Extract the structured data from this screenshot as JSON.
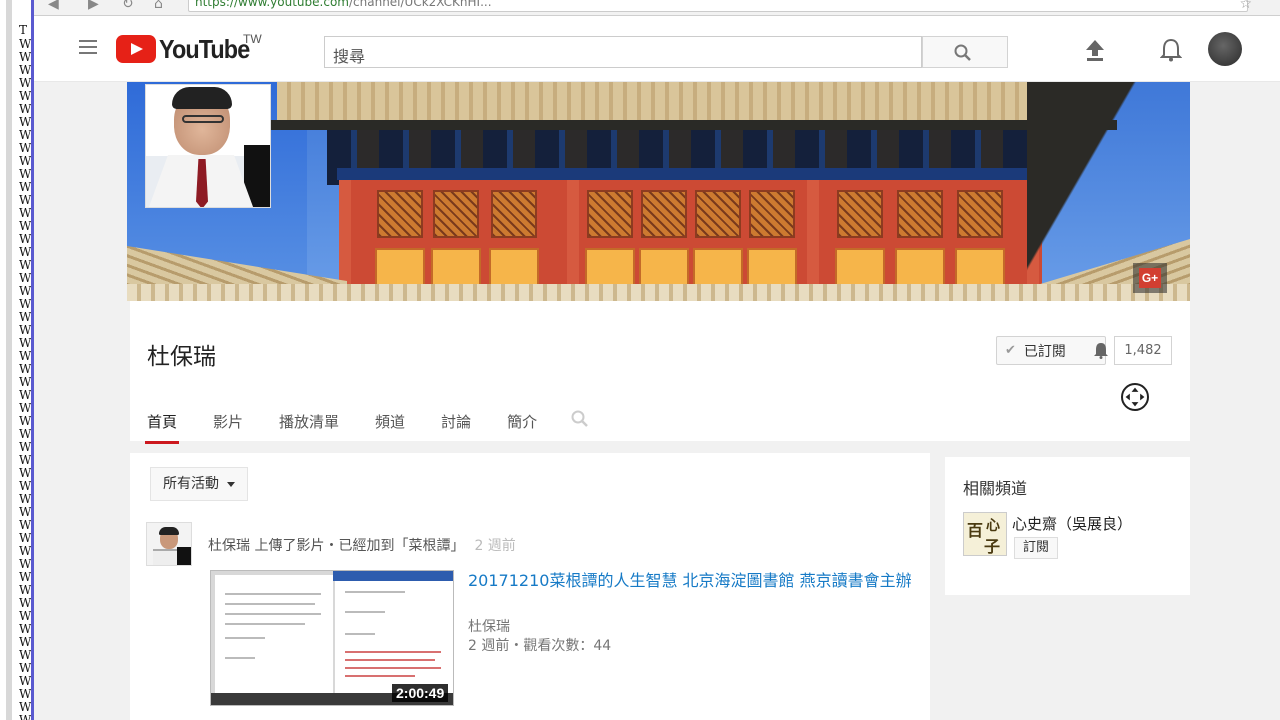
{
  "browser": {
    "url_prefix": "https://www.youtube.com",
    "url_rest": "/channel/UCk2XCKnHI..."
  },
  "left_window": {
    "top_letter": "T",
    "letters": [
      "W",
      "W",
      "W",
      "W",
      "W",
      "W",
      "W",
      "W",
      "W",
      "W",
      "W",
      "W",
      "W",
      "W",
      "W",
      "W",
      "W",
      "W",
      "W",
      "W",
      "W",
      "W",
      "W",
      "W",
      "W",
      "W",
      "W",
      "W",
      "W",
      "W",
      "W",
      "W",
      "W",
      "W",
      "W",
      "W",
      "W",
      "W",
      "W",
      "W",
      "W",
      "W",
      "W",
      "W",
      "W",
      "W",
      "W",
      "W",
      "W",
      "W",
      "W",
      "W",
      "W"
    ]
  },
  "header": {
    "logo_text": "YouTube",
    "region": "TW",
    "search_placeholder": "搜尋"
  },
  "channel": {
    "name": "杜保瑞",
    "subscribe_label": "已訂閱",
    "subscriber_count": "1,482",
    "gplus_label": "G+",
    "tabs": [
      "首頁",
      "影片",
      "播放清單",
      "頻道",
      "討論",
      "簡介"
    ],
    "active_tab": "首頁"
  },
  "feed": {
    "filter_label": "所有活動",
    "activity_text": "杜保瑞 上傳了影片・已經加到「菜根譚」",
    "activity_time": "2 週前",
    "video": {
      "title": "20171210菜根譚的人生智慧 北京海淀圖書館 燕京讀書會主辦",
      "channel": "杜保瑞",
      "meta": "2 週前・觀看次數：44",
      "duration": "2:00:49"
    }
  },
  "related": {
    "title": "相關頻道",
    "channel_name": "心史齋（吳展良）",
    "subscribe_label": "訂閱",
    "thumb_text": [
      "百",
      "心",
      "子"
    ]
  },
  "colors": {
    "brand_red": "#e62117",
    "link_blue": "#167ac6",
    "tab_underline": "#cc181e"
  },
  "icons": [
    "menu-icon",
    "youtube-play-icon",
    "search-icon",
    "upload-icon",
    "bell-icon",
    "check-icon",
    "notification-bell-icon",
    "move-cursor-icon"
  ]
}
